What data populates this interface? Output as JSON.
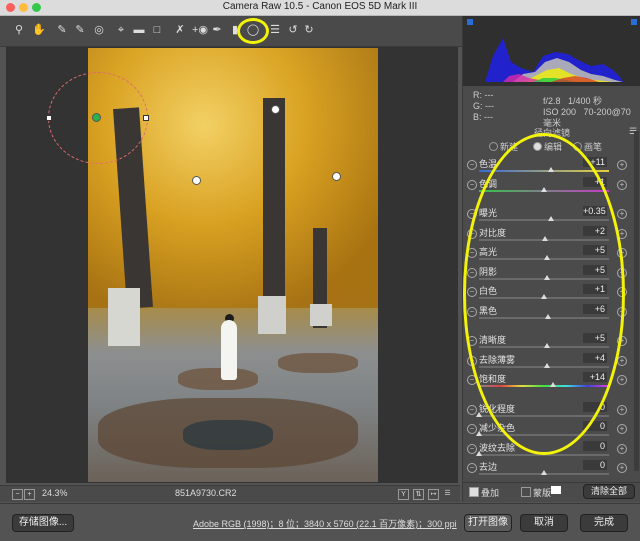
{
  "window": {
    "title": "Camera Raw 10.5 - Canon EOS 5D Mark III"
  },
  "toolbar": {
    "tools": [
      "zoom-tool-icon",
      "hand-tool-icon",
      "white-balance-tool-icon",
      "color-sampler-tool-icon",
      "targeted-adjustment-tool-icon",
      "crop-tool-icon",
      "straighten-tool-icon",
      "transform-tool-icon",
      "spot-removal-tool-icon",
      "red-eye-tool-icon",
      "adjustment-brush-tool-icon",
      "graduated-filter-tool-icon",
      "radial-filter-tool-icon",
      "preferences-icon",
      "rotate-left-icon",
      "rotate-right-icon",
      "fullscreen-icon"
    ]
  },
  "readout": {
    "r": "R:  ---",
    "g": "G:  ---",
    "b": "B:  ---"
  },
  "camera": {
    "aperture": "f/2.8",
    "shutter": "1/400 秒",
    "iso": "ISO 200",
    "lens": "70-200@70 毫米"
  },
  "panel": {
    "title": "径向滤镜",
    "modes": [
      {
        "label": "新建",
        "selected": false
      },
      {
        "label": "编辑",
        "selected": true
      },
      {
        "label": "画笔",
        "selected": false
      }
    ],
    "sliders": [
      {
        "label": "色温",
        "value": "+11",
        "pos": 0.55,
        "group": 1
      },
      {
        "label": "色调",
        "value": "+1",
        "pos": 0.5,
        "group": 1
      },
      {
        "label": "曝光",
        "value": "+0.35",
        "pos": 0.55,
        "group": 2
      },
      {
        "label": "对比度",
        "value": "+2",
        "pos": 0.51,
        "group": 2
      },
      {
        "label": "高光",
        "value": "+5",
        "pos": 0.52,
        "group": 2
      },
      {
        "label": "阴影",
        "value": "+5",
        "pos": 0.52,
        "group": 2
      },
      {
        "label": "白色",
        "value": "+1",
        "pos": 0.5,
        "group": 2
      },
      {
        "label": "黑色",
        "value": "+6",
        "pos": 0.53,
        "group": 2
      },
      {
        "label": "清晰度",
        "value": "+5",
        "pos": 0.52,
        "group": 3
      },
      {
        "label": "去除薄雾",
        "value": "+4",
        "pos": 0.52,
        "group": 3
      },
      {
        "label": "饱和度",
        "value": "+14",
        "pos": 0.57,
        "group": 3
      },
      {
        "label": "锐化程度",
        "value": "0",
        "pos": 0.0,
        "group": 4
      },
      {
        "label": "减少杂色",
        "value": "0",
        "pos": 0.0,
        "group": 4
      },
      {
        "label": "波纹去除",
        "value": "0",
        "pos": 0.0,
        "group": 4
      },
      {
        "label": "去边",
        "value": "0",
        "pos": 0.5,
        "group": 4
      }
    ],
    "overlay_label": "叠加",
    "mask_label": "蒙版",
    "clear_all_label": "清除全部"
  },
  "status": {
    "zoom": "24.3%",
    "filename": "851A9730.CR2"
  },
  "footer": {
    "save_label": "存储图像...",
    "info": "Adobe RGB (1998)；8 位；3840 x 5760 (22.1 百万像素)；300 ppi",
    "open_label": "打开图像",
    "cancel_label": "取消",
    "done_label": "完成"
  },
  "colors": {
    "highlight": "#f2f20a",
    "panel_bg": "#4b4b4b",
    "toolbar_bg": "#4a4a4a"
  }
}
